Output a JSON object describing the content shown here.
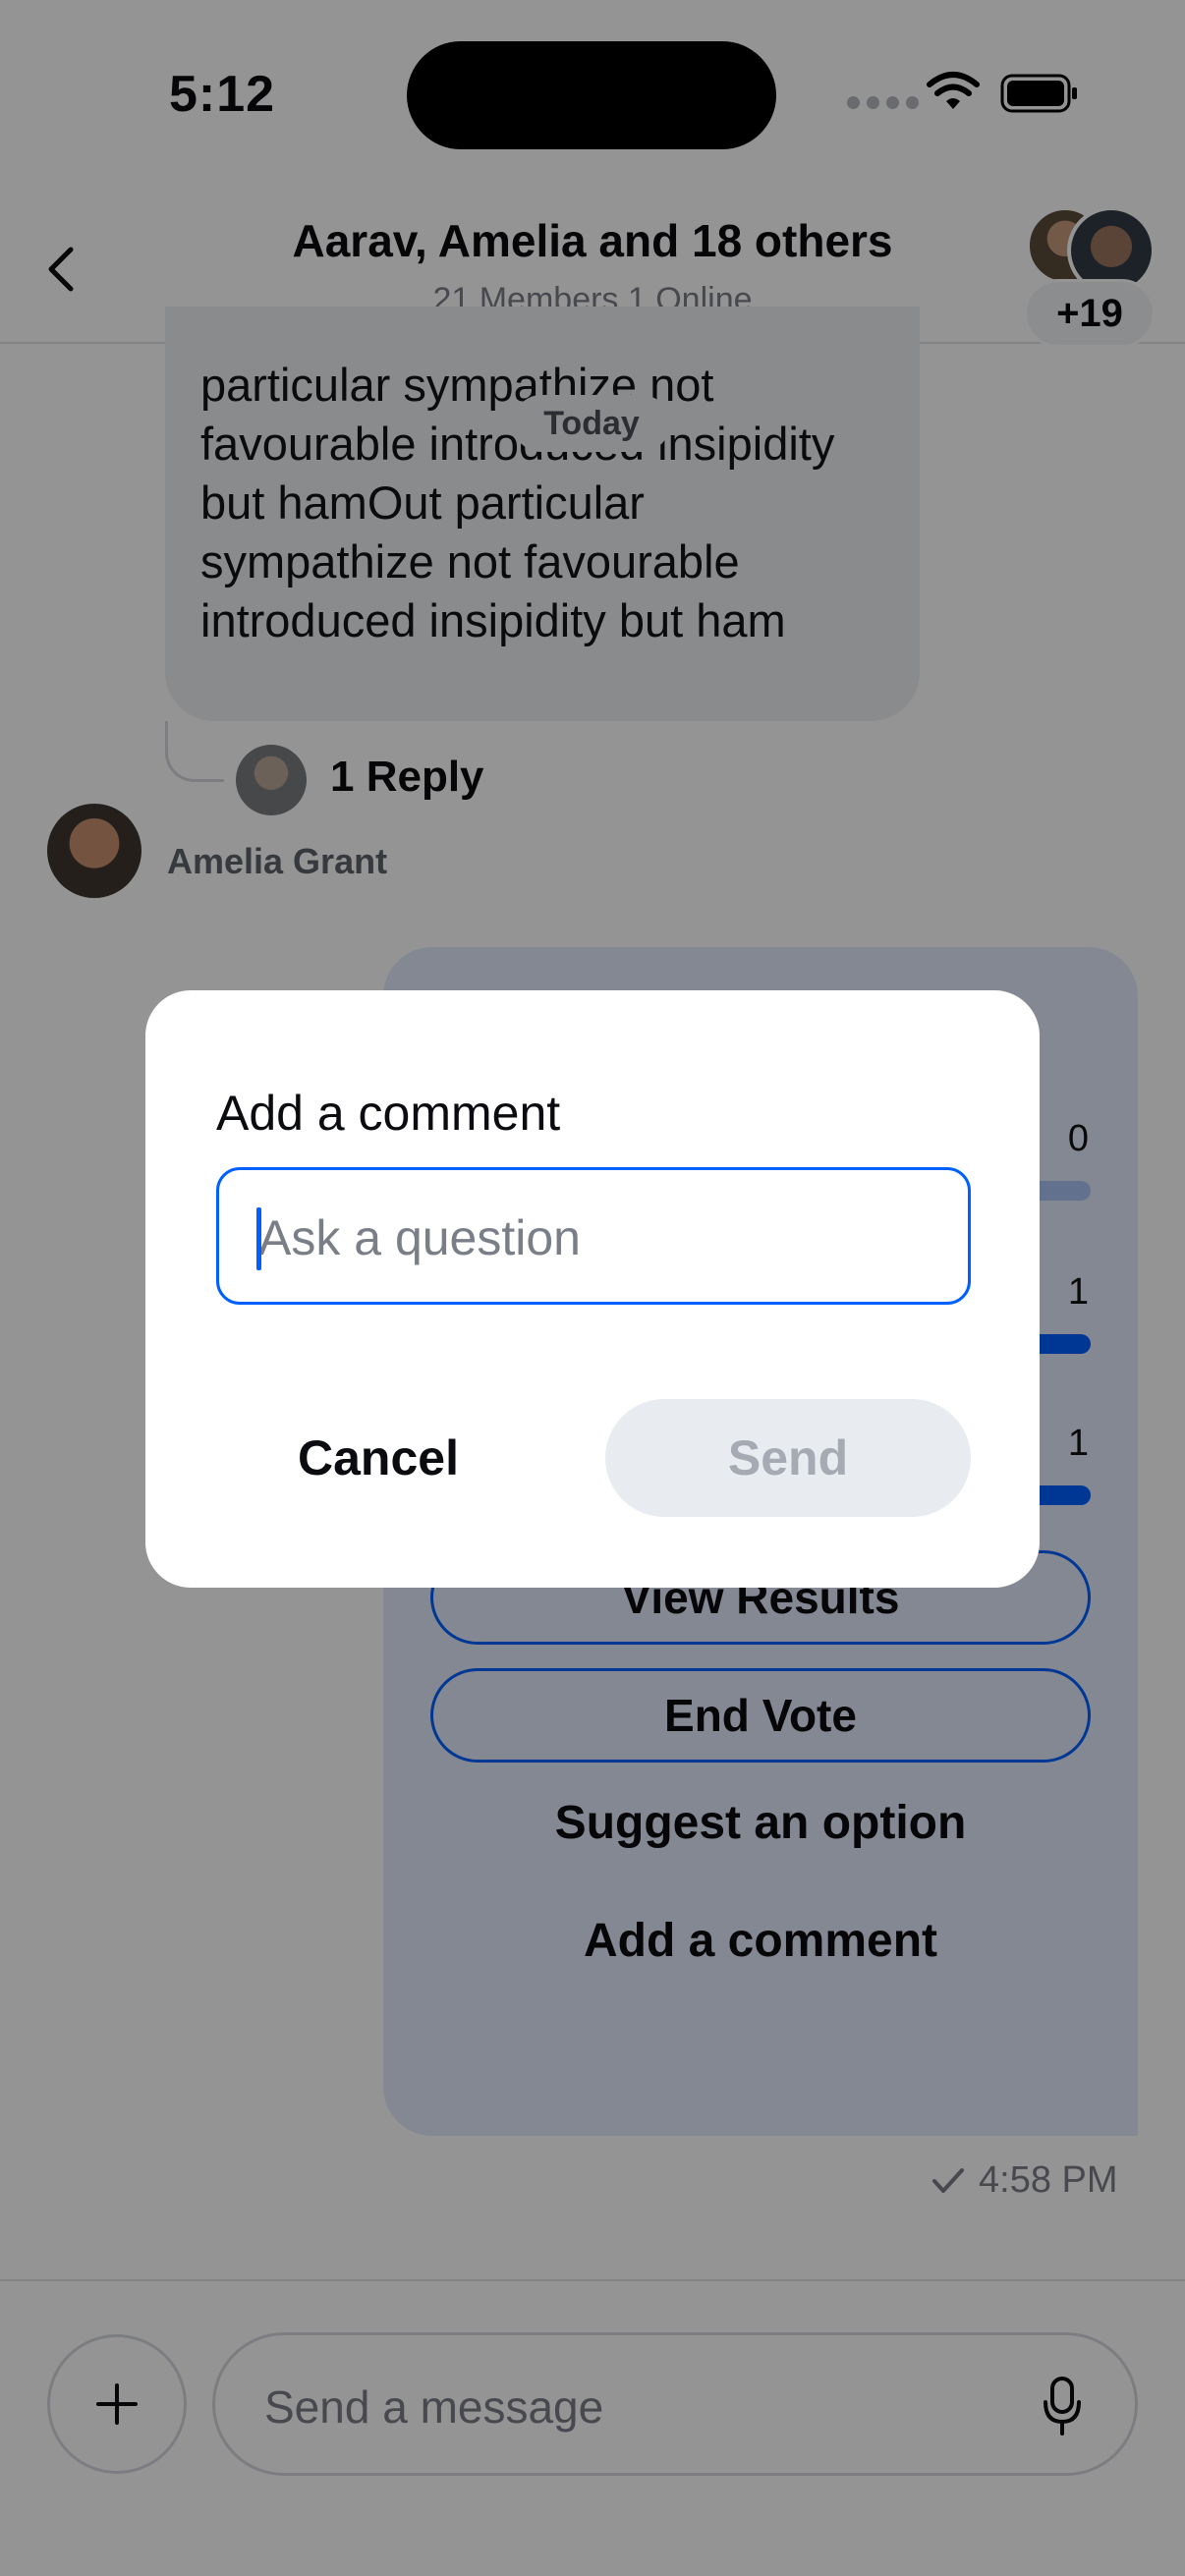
{
  "status_bar": {
    "time": "5:12"
  },
  "header": {
    "title": "Aarav, Amelia and 18 others",
    "subtitle": "21 Members,1 Online",
    "extra_members_badge": "+19"
  },
  "chat": {
    "date_separator": "Today",
    "previous_message_text": "particular sympathize not favourable introduced insipidity but hamOut particular sympathize not favourable introduced insipidity but ham",
    "reply_count": "1 Reply",
    "sender_name": "Amelia Grant",
    "poll": {
      "option_counts": [
        "0",
        "1",
        "1"
      ],
      "view_results_label": "View Results",
      "end_vote_label": "End Vote",
      "suggest_option_label": "Suggest an option",
      "add_comment_label": "Add a comment"
    },
    "message_time": "4:58 PM"
  },
  "composer": {
    "placeholder": "Send a message"
  },
  "dialog": {
    "title": "Add a comment",
    "input_value": "",
    "input_placeholder": "Ask a question",
    "cancel_label": "Cancel",
    "send_label": "Send"
  },
  "icons": {
    "back": "chevron-left-icon",
    "plus": "plus-icon",
    "mic": "microphone-icon",
    "wifi": "wifi-icon",
    "battery": "battery-icon",
    "read_receipt": "checkmark-icon"
  },
  "colors": {
    "accent": "#005fff",
    "poll_bubble": "#e2ebfd",
    "incoming_bubble": "#eef0f3"
  }
}
